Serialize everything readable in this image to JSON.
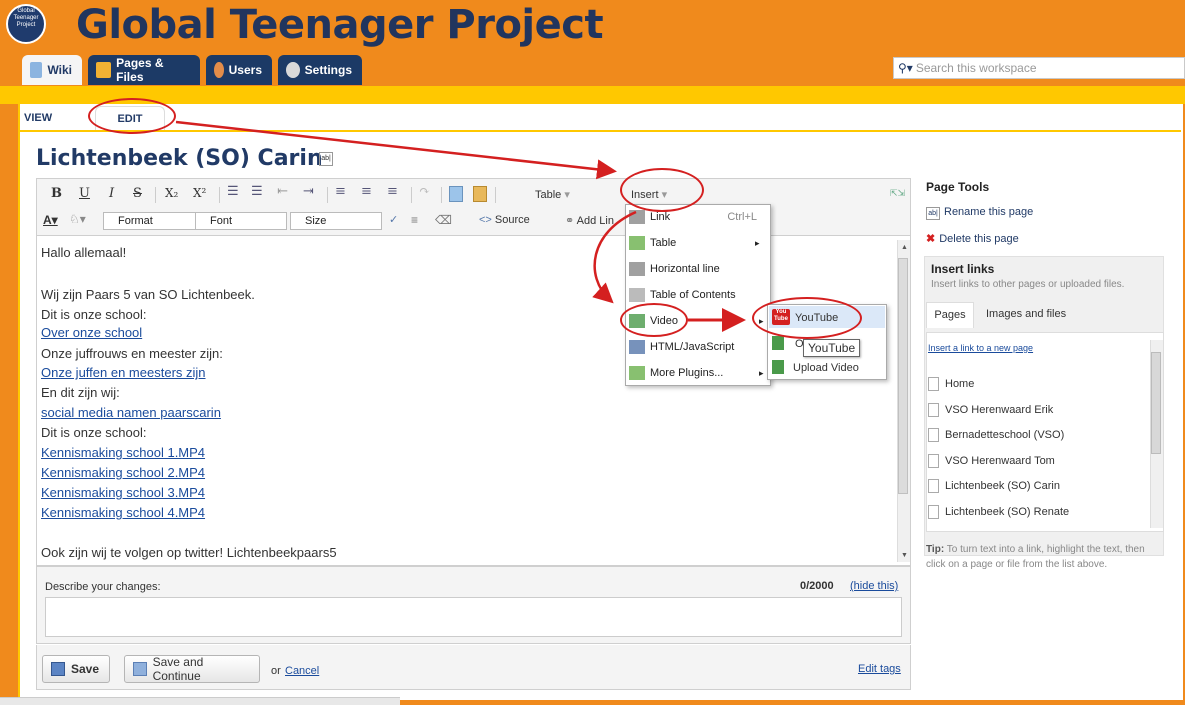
{
  "site": {
    "title": "Global Teenager Project",
    "logo_text": "Global Teenager Project"
  },
  "nav_tabs": [
    {
      "label": "Wiki",
      "icon": "wiki-icon"
    },
    {
      "label": "Pages & Files",
      "icon": "folder-icon"
    },
    {
      "label": "Users",
      "icon": "users-icon"
    },
    {
      "label": "Settings",
      "icon": "gear-icon"
    }
  ],
  "search": {
    "placeholder": "Search this workspace"
  },
  "mode_tabs": {
    "view": "VIEW",
    "edit": "EDIT"
  },
  "page": {
    "title": "Lichtenbeek (SO) Carin"
  },
  "toolbar": {
    "bold": "B",
    "underline": "U",
    "italic": "I",
    "strike": "S",
    "subscript": "X₂",
    "superscript": "X²",
    "table_label": "Table",
    "insert_label": "Insert",
    "format_label": "Format",
    "font_label": "Font",
    "size_label": "Size",
    "source_label": "Source",
    "add_link_label": "Add Lin"
  },
  "editor_lines": [
    {
      "text": "Hallo allemaal!",
      "link": false
    },
    {
      "text": "",
      "link": false
    },
    {
      "text": "Wij zijn Paars 5 van SO Lichtenbeek.",
      "link": false
    },
    {
      "text": "Dit is onze school:",
      "link": false
    },
    {
      "text": "Over onze school",
      "link": true
    },
    {
      "text": "Onze juffrouws en meester zijn:",
      "link": false
    },
    {
      "text": "Onze juffen en meesters zijn",
      "link": true
    },
    {
      "text": "En dit zijn wij:",
      "link": false
    },
    {
      "text": "social media namen paarscarin",
      "link": true
    },
    {
      "text": "Dit is onze school:",
      "link": false
    },
    {
      "text": "Kennismaking school 1.MP4",
      "link": true
    },
    {
      "text": "Kennismaking school 2.MP4",
      "link": true
    },
    {
      "text": "Kennismaking school 3.MP4",
      "link": true
    },
    {
      "text": "Kennismaking school 4.MP4",
      "link": true
    },
    {
      "text": "",
      "link": false
    },
    {
      "text": "Ook zijn wij te volgen op twitter! Lichtenbeekpaars5",
      "link": false
    }
  ],
  "insert_menu": {
    "items": [
      {
        "label": "Link",
        "shortcut": "Ctrl+L",
        "icon": "link-icon"
      },
      {
        "label": "Table",
        "shortcut": "",
        "icon": "table-icon"
      },
      {
        "label": "Horizontal line",
        "shortcut": "",
        "icon": "horizontal-line-icon"
      },
      {
        "label": "Table of Contents",
        "shortcut": "",
        "icon": "toc-icon"
      },
      {
        "label": "Video",
        "shortcut": "",
        "icon": "video-icon"
      },
      {
        "label": "HTML/JavaScript",
        "shortcut": "",
        "icon": "code-icon"
      },
      {
        "label": "More Plugins...",
        "shortcut": "",
        "icon": "puzzle-icon"
      }
    ]
  },
  "video_submenu": {
    "items": [
      {
        "label": "YouTube",
        "icon": "youtube-icon"
      },
      {
        "label": "O",
        "icon": "video-file-icon"
      },
      {
        "label": "Upload Video",
        "icon": "upload-video-icon"
      }
    ],
    "youtube_icon_text": "You\nTube"
  },
  "tooltip": "YouTube",
  "describe": {
    "label": "Describe your changes:",
    "counter": "0/2000",
    "hide_link": "(hide this)"
  },
  "buttons": {
    "save": "Save",
    "save_continue": "Save and Continue",
    "or_text": "or",
    "cancel": "Cancel",
    "edit_tags": "Edit tags"
  },
  "sidebar": {
    "page_tools_title": "Page Tools",
    "rename": "Rename this page",
    "delete": "Delete this page",
    "insert_links_title": "Insert links",
    "insert_links_desc": "Insert links to other pages or uploaded files.",
    "tabs": [
      "Pages",
      "Images and files"
    ],
    "new_page_link": "Insert a link to a new page",
    "pages": [
      "Home",
      "VSO Herenwaard Erik",
      "Bernadetteschool (VSO)",
      "VSO Herenwaard Tom",
      "Lichtenbeek (SO) Carin",
      "Lichtenbeek (SO) Renate"
    ],
    "tip_bold": "Tip:",
    "tip": "To turn text into a link, highlight the text, then click on a page or file from the list above."
  },
  "colors": {
    "orange": "#f08a1c",
    "navy": "#213a66",
    "yellow": "#ffc800",
    "annotation_red": "#d42020"
  }
}
